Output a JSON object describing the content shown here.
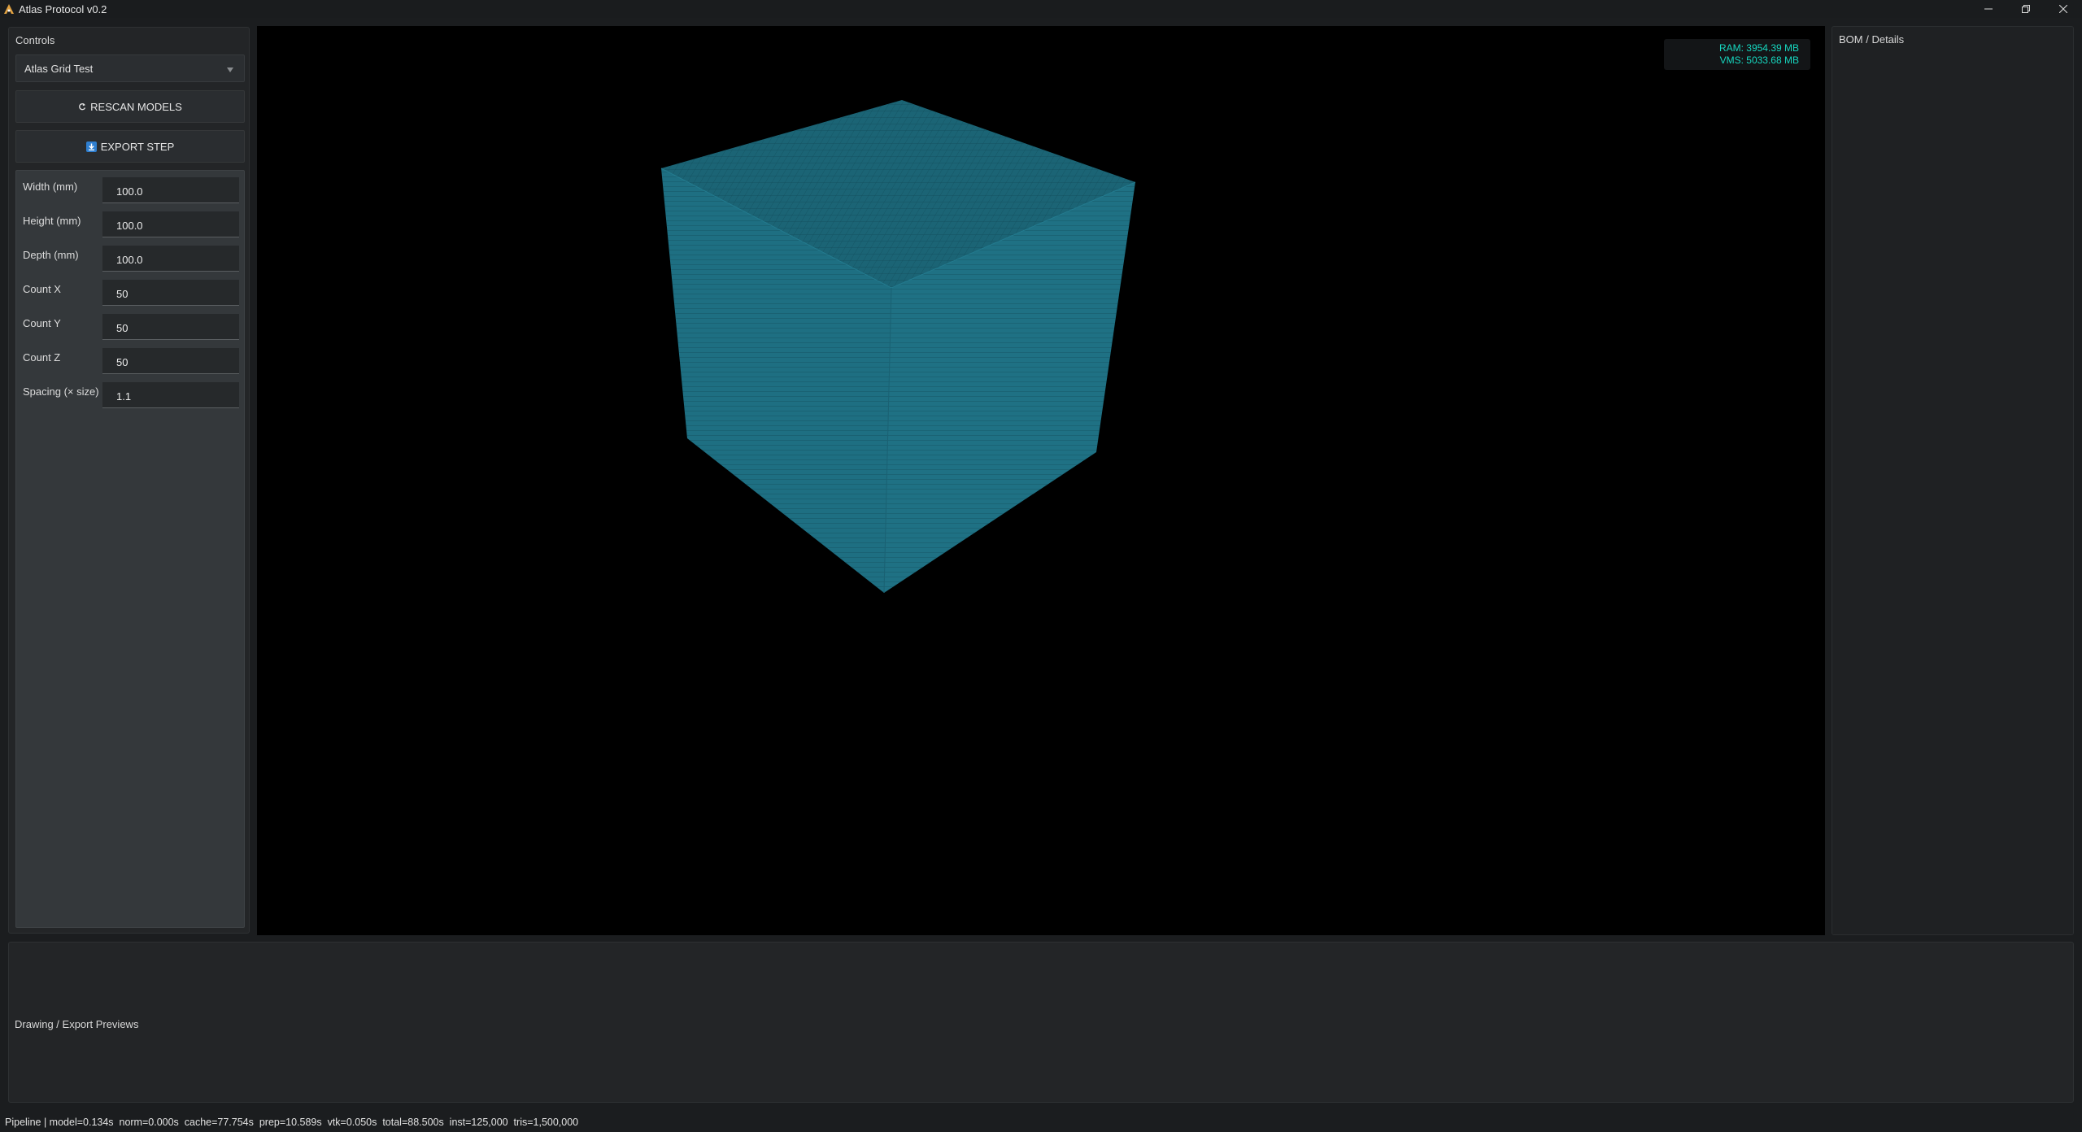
{
  "window": {
    "title": "Atlas Protocol v0.2",
    "controls": {
      "minimize": "minimize-icon",
      "restore": "restore-icon",
      "close": "close-icon"
    }
  },
  "left_panel": {
    "title": "Controls",
    "model_select": {
      "value": "Atlas Grid Test",
      "icon": "chevron-down-icon"
    },
    "rescan_button": {
      "label": "RESCAN MODELS",
      "icon": "refresh-icon"
    },
    "export_button": {
      "label": "EXPORT STEP",
      "icon": "download-icon"
    },
    "params": [
      {
        "label": "Width (mm)",
        "value": "100.0"
      },
      {
        "label": "Height (mm)",
        "value": "100.0"
      },
      {
        "label": "Depth (mm)",
        "value": "100.0"
      },
      {
        "label": "Count X",
        "value": "50"
      },
      {
        "label": "Count Y",
        "value": "50"
      },
      {
        "label": "Count Z",
        "value": "50"
      },
      {
        "label": "Spacing (× size)",
        "value": "1.1"
      }
    ]
  },
  "viewport": {
    "ram": "RAM: 3954.39 MB",
    "vms": "VMS: 5033.68 MB",
    "overlay_color": "#16d8c0",
    "model_color": "#1e6f82"
  },
  "right_panel": {
    "title": "BOM / Details"
  },
  "bottom_panel": {
    "title": "Drawing / Export Previews"
  },
  "status_bar": {
    "text": "Pipeline | model=0.134s  norm=0.000s  cache=77.754s  prep=10.589s  vtk=0.050s  total=88.500s  inst=125,000  tris=1,500,000"
  }
}
